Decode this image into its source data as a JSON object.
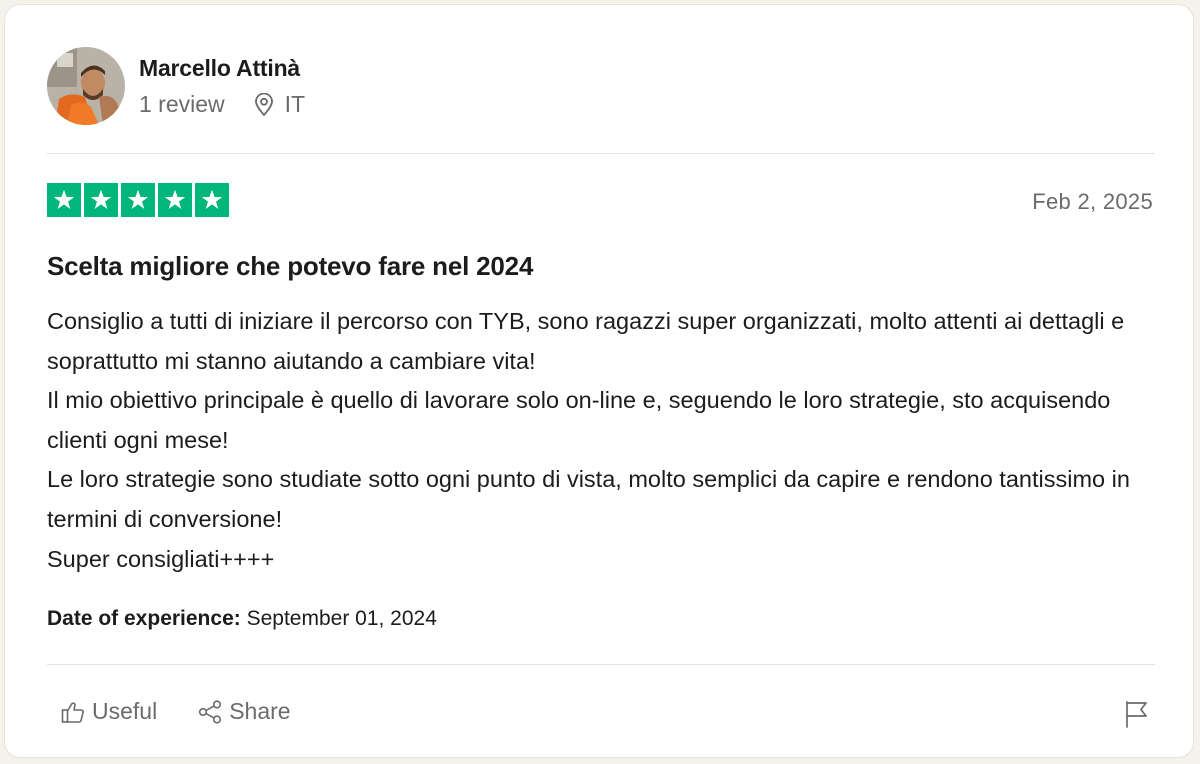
{
  "reviewer": {
    "name": "Marcello Attinà",
    "review_count": "1 review",
    "country": "IT",
    "avatar_icon": "user-photo"
  },
  "rating": {
    "stars": 5,
    "max": 5,
    "color": "#00b67a",
    "date": "Feb 2, 2025"
  },
  "review": {
    "title": "Scelta migliore che potevo fare nel 2024",
    "lines": [
      "Consiglio a tutti di iniziare il percorso con TYB, sono ragazzi super organizzati, molto attenti ai dettagli e soprattutto mi stanno aiutando a cambiare vita!",
      "Il mio obiettivo principale è quello di lavorare solo on-line e, seguendo le loro strategie, sto acquisendo clienti ogni mese!",
      "Le loro strategie sono studiate sotto ogni punto di vista, molto semplici da capire e rendono tantissimo in termini di conversione!",
      "Super consigliati++++"
    ]
  },
  "experience": {
    "label": "Date of experience:",
    "date": "September 01, 2024"
  },
  "actions": {
    "useful_label": "Useful",
    "share_label": "Share",
    "useful_icon": "thumbs-up-icon",
    "share_icon": "share-icon",
    "flag_icon": "flag-icon"
  }
}
